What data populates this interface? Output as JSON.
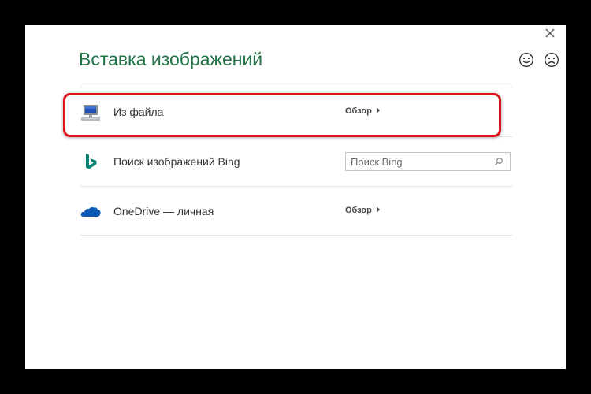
{
  "dialog": {
    "title": "Вставка изображений",
    "close_icon": "close-icon",
    "feedback": {
      "smile_icon": "smile-icon",
      "frown_icon": "frown-icon"
    }
  },
  "options": [
    {
      "id": "from-file",
      "icon": "computer-icon",
      "label": "Из файла",
      "action": "Обзор",
      "highlighted": true
    },
    {
      "id": "bing",
      "icon": "bing-logo-icon",
      "label": "Поиск изображений Bing",
      "search_placeholder": "Поиск Bing",
      "search_value": ""
    },
    {
      "id": "onedrive",
      "icon": "onedrive-cloud-icon",
      "label": "OneDrive — личная",
      "action": "Обзор"
    }
  ],
  "colors": {
    "title": "#217346",
    "bing_logo": "#008373",
    "onedrive_cloud": "#0a5ab3",
    "highlight_border": "#e0141e",
    "backdrop": "#000000"
  }
}
